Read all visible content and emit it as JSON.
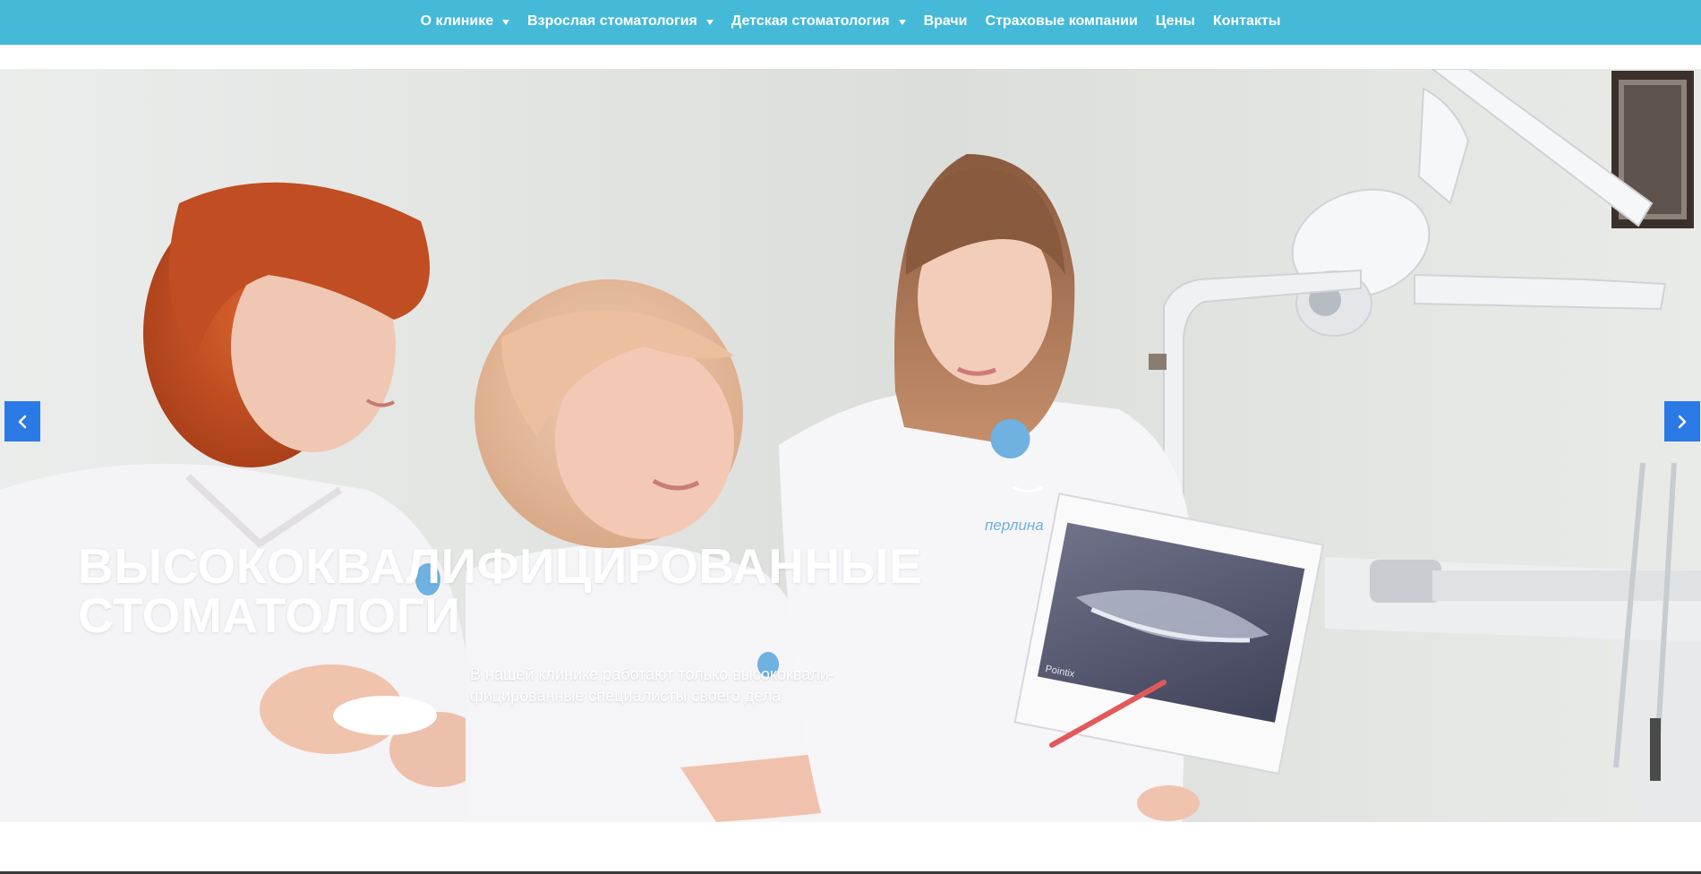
{
  "colors": {
    "nav_background": "#45b9d8",
    "nav_text": "#ffffff",
    "slider_arrow": "#2b79e4",
    "caption_text": "#ffffff",
    "shirt_logo": "#6fb1e0"
  },
  "nav": {
    "items": [
      {
        "label": "О клинике",
        "has_dropdown": true
      },
      {
        "label": "Взрослая стоматология",
        "has_dropdown": true
      },
      {
        "label": "Детская стоматология",
        "has_dropdown": true
      },
      {
        "label": "Врачи",
        "has_dropdown": false
      },
      {
        "label": "Страховые компании",
        "has_dropdown": false
      },
      {
        "label": "Цены",
        "has_dropdown": false
      },
      {
        "label": "Контакты",
        "has_dropdown": false
      }
    ],
    "dropdown_icon": "caret-down-icon"
  },
  "slider": {
    "heading_line1": "ВЫСОКОКВАЛИФИЦИРОВАННЫЕ",
    "heading_line2": "СТОМАТОЛОГИ",
    "text_line1": "В нашей клинике работают только высококвали-",
    "text_line2": "фицированные специалисты своего дела",
    "photo_description": "three dentists in white polo shirts looking at a dental panoramic x-ray",
    "shirt_logo_text": "перлина",
    "xray_label": "Pointix",
    "prev_icon": "chevron-left-icon",
    "next_icon": "chevron-right-icon"
  }
}
